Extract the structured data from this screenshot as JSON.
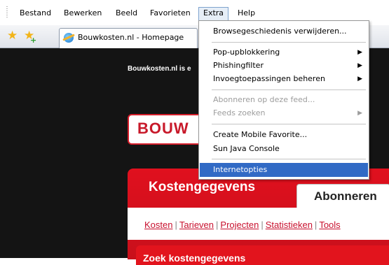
{
  "menubar": {
    "items": [
      "Bestand",
      "Bewerken",
      "Beeld",
      "Favorieten",
      "Extra",
      "Help"
    ],
    "active": "Extra"
  },
  "toolbar": {
    "tab_title": "Bouwkosten.nl - Homepage",
    "favorites_icon": "star-icon",
    "add_favorite_icon": "star-plus-icon"
  },
  "extra_menu": {
    "items": [
      {
        "label": "Browsegeschiedenis verwijderen...",
        "disabled": false,
        "submenu": false
      },
      {
        "label": "Pop-upblokkering",
        "disabled": false,
        "submenu": true
      },
      {
        "label": "Phishingfilter",
        "disabled": false,
        "submenu": true
      },
      {
        "label": "Invoegtoepassingen beheren",
        "disabled": false,
        "submenu": true
      },
      {
        "label": "Abonneren op deze feed...",
        "disabled": true,
        "submenu": false
      },
      {
        "label": "Feeds zoeken",
        "disabled": true,
        "submenu": true
      },
      {
        "label": "Create Mobile Favorite...",
        "disabled": false,
        "submenu": false
      },
      {
        "label": "Sun Java Console",
        "disabled": false,
        "submenu": false
      },
      {
        "label": "Internetopties",
        "disabled": false,
        "submenu": false,
        "highlighted": true
      }
    ]
  },
  "page": {
    "banner_text": "Bouwkosten.nl is e",
    "logo_text": "BOUW",
    "panel_title": "Kostengegevens",
    "tab_abonneren": "Abonneren",
    "subnav": [
      "Kosten",
      "Tarieven",
      "Projecten",
      "Statistieken",
      "Tools"
    ],
    "search_title": "Zoek kostengegevens"
  },
  "colors": {
    "brand_red": "#e0101e",
    "menu_highlight": "#316ac5"
  }
}
